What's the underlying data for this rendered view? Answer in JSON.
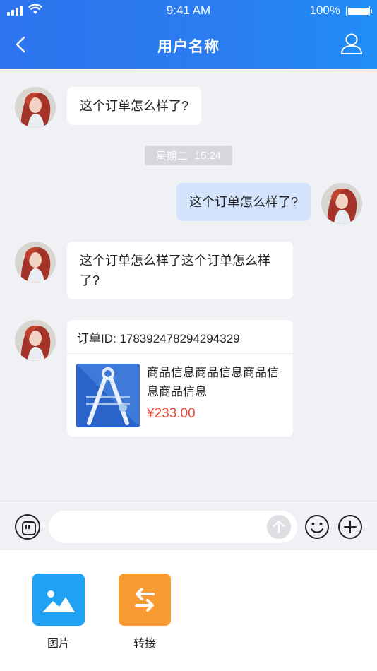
{
  "status_bar": {
    "time": "9:41 AM",
    "battery": "100%"
  },
  "header": {
    "title": "用户名称",
    "back_icon": "chevron-left-icon",
    "right_icon": "user-profile-icon"
  },
  "messages": [
    {
      "side": "left",
      "text": "这个订单怎么样了?"
    },
    {
      "side": "right",
      "text": "这个订单怎么样了?"
    },
    {
      "side": "left",
      "text": "这个订单怎么样了这个订单怎么样了?"
    }
  ],
  "timestamp": {
    "day": "星期二",
    "time": "15:24"
  },
  "order_card": {
    "order_id": "订单ID: 178392478294294329",
    "product_name": "商品信息商品信息商品信息商品信息",
    "price": "¥233.00"
  },
  "input_bar": {
    "placeholder": ""
  },
  "panel": {
    "items": [
      {
        "label": "图片",
        "icon": "image-icon",
        "color": "#1fa2f3"
      },
      {
        "label": "转接",
        "icon": "transfer-icon",
        "color": "#f89b33"
      }
    ]
  },
  "colors": {
    "header_blue": "#2d74ee",
    "my_bubble": "#d3e3fc",
    "price_red": "#ee4a3b"
  }
}
